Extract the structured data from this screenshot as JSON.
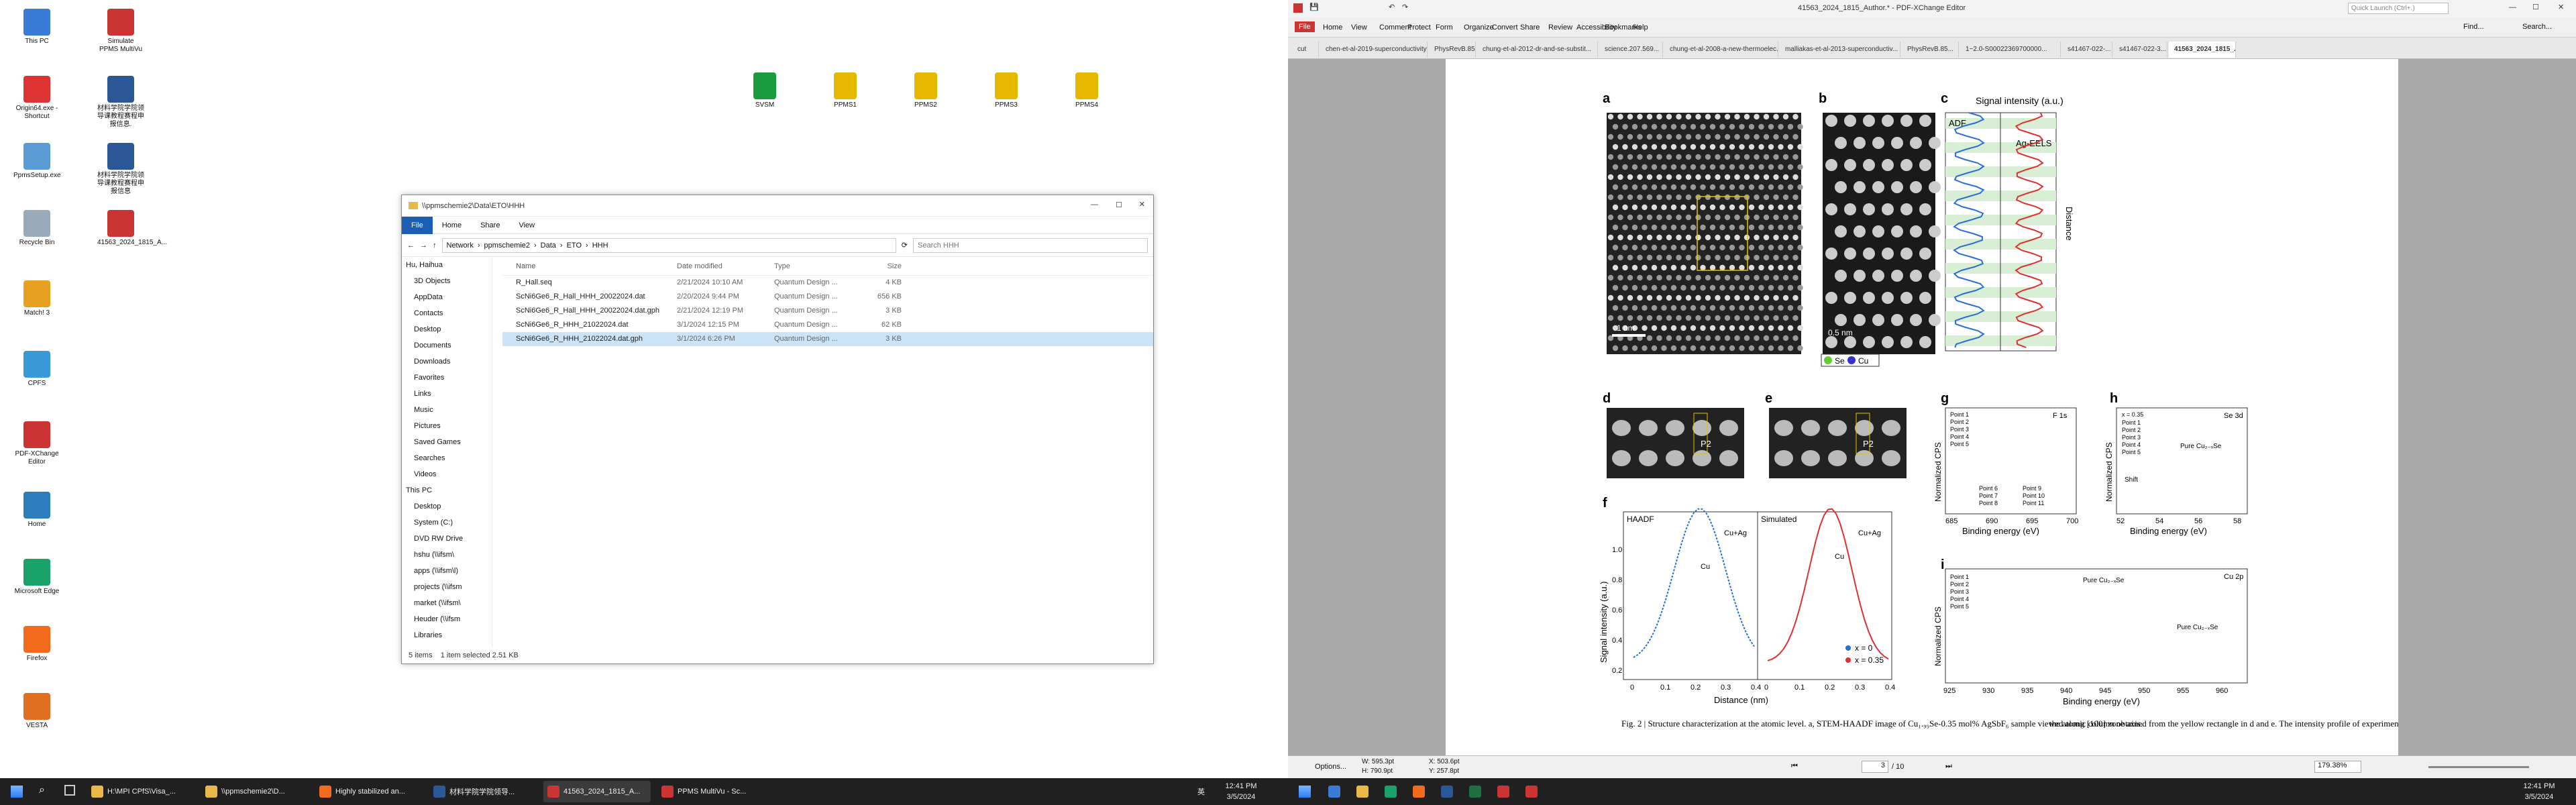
{
  "desktop_left": {
    "icons": [
      {
        "label": "This PC",
        "color": "#3a7bd5"
      },
      {
        "label": "Simulate PPMS MultiVu",
        "color": "#c33"
      },
      {
        "label": "Origin64.exe - Shortcut",
        "color": "#d33"
      },
      {
        "label": "材料学院学院领导课教程赛程申报信息.",
        "color": "#2b5797"
      },
      {
        "label": "PpmsSetup.exe",
        "color": "#5b9bd5"
      },
      {
        "label": "材料学院学院领导课教程赛程申报信息",
        "color": "#2b5797"
      },
      {
        "label": "Recycle Bin",
        "color": "#9ab"
      },
      {
        "label": "41563_2024_1815_A...",
        "color": "#c33"
      },
      {
        "label": "Match! 3",
        "color": "#e8a020"
      },
      {
        "label": "CPFS",
        "color": "#3a9ad9"
      },
      {
        "label": "PDF-XChange Editor",
        "color": "#c33"
      },
      {
        "label": "Home",
        "color": "#2c7dbe"
      },
      {
        "label": "Microsoft Edge",
        "color": "#1aa26b"
      },
      {
        "label": "Firefox",
        "color": "#f26b1d"
      },
      {
        "label": "VESTA",
        "color": "#e07020"
      }
    ],
    "shortcuts": [
      {
        "label": "SVSM",
        "color": "#1a9c3e"
      },
      {
        "label": "PPMS1",
        "color": "#e6b800"
      },
      {
        "label": "PPMS2",
        "color": "#e6b800"
      },
      {
        "label": "PPMS3",
        "color": "#e6b800"
      },
      {
        "label": "PPMS4",
        "color": "#e6b800"
      }
    ]
  },
  "explorer": {
    "title": "\\\\ppmschemie2\\Data\\ETO\\HHH",
    "ribbon": [
      "File",
      "Home",
      "Share",
      "View"
    ],
    "path": [
      "Network",
      "ppmschemie2",
      "Data",
      "ETO",
      "HHH"
    ],
    "search_placeholder": "Search HHH",
    "nav": [
      "Hu, Haihua",
      "3D Objects",
      "AppData",
      "Contacts",
      "Desktop",
      "Documents",
      "Downloads",
      "Favorites",
      "Links",
      "Music",
      "Pictures",
      "Saved Games",
      "Searches",
      "Videos",
      "This PC",
      "Desktop",
      "System (C:)",
      "DVD RW Drive",
      "hshu (\\\\ifsm\\",
      "apps (\\\\ifsm\\l)",
      "projects (\\\\ifsm",
      "market (\\\\ifsm\\",
      "Heuder (\\\\ifsm",
      "Libraries"
    ],
    "columns": [
      "Name",
      "Date modified",
      "Type",
      "Size"
    ],
    "files": [
      {
        "name": "R_Hall.seq",
        "date": "2/21/2024 10:10 AM",
        "type": "Quantum Design ...",
        "size": "4 KB"
      },
      {
        "name": "ScNi6Ge6_R_Hall_HHH_20022024.dat",
        "date": "2/20/2024 9:44 PM",
        "type": "Quantum Design ...",
        "size": "656 KB"
      },
      {
        "name": "ScNi6Ge6_R_Hall_HHH_20022024.dat.gph",
        "date": "2/21/2024 12:19 PM",
        "type": "Quantum Design ...",
        "size": "3 KB"
      },
      {
        "name": "ScNi6Ge6_R_HHH_21022024.dat",
        "date": "3/1/2024 12:15 PM",
        "type": "Quantum Design ...",
        "size": "62 KB"
      },
      {
        "name": "ScNi6Ge6_R_HHH_21022024.dat.gph",
        "date": "3/1/2024 6:26 PM",
        "type": "Quantum Design ...",
        "size": "3 KB"
      }
    ],
    "status": [
      "5 items",
      "1 item selected 2.51 KB"
    ]
  },
  "taskbar_left": {
    "items": [
      "H:\\MPI CPfS\\Visa_...",
      "\\\\ppmschemie2\\D...",
      "Highly stabilized an...",
      "材料学院学院领导...",
      "41563_2024_1815_A...",
      "PPMS MultiVu - Sc..."
    ],
    "time": "12:41 PM",
    "date": "3/5/2024",
    "lang": "英"
  },
  "taskbar_right": {
    "time": "12:41 PM",
    "date": "3/5/2024"
  },
  "pdf": {
    "title": "41563_2024_1815_Author.* - PDF-XChange Editor",
    "quick_launch": "Quick Launch (Ctrl+.)",
    "menu": [
      "File",
      "Home",
      "View",
      "Comment",
      "Protect",
      "Form",
      "Organize",
      "Convert",
      "Share",
      "Review",
      "Accessibility",
      "Bookmarks",
      "Help"
    ],
    "find": "Find...",
    "search": "Search...",
    "tabs": [
      "cut",
      "chen-et-al-2019-superconductivity-a...",
      "PhysRevB.85...",
      "chung-et-al-2012-dr-and-se-substit...",
      "science.207.569...",
      "chung-et-al-2008-a-new-thermoelec...",
      "malliakas-et-al-2013-superconductiv...",
      "PhysRevB.85...",
      "1~2.0-S00022369700000...",
      "s41467-022-...",
      "s41467-022-3...",
      "41563_2024_1815_..."
    ],
    "status": {
      "options": "Options...",
      "w": "W: 595.3pt",
      "h": "H: 790.9pt",
      "x": "X: 503.6pt",
      "y": "Y: 257.8pt",
      "page": "3",
      "total": "/ 10",
      "zoom": "179.38%"
    }
  },
  "figure": {
    "panels": [
      "a",
      "b",
      "c",
      "d",
      "e",
      "f",
      "g",
      "h",
      "i"
    ],
    "scale_a": "1 nm",
    "scale_b": "0.5 nm",
    "legend_b": [
      "Se",
      "Cu"
    ],
    "c_title": "Signal intensity (a.u.)",
    "c_adf": "ADF",
    "c_eels": "Ag-EELS",
    "c_dist": "Distance",
    "d_label": "P2",
    "e_label": "P2",
    "f": {
      "ylabel": "Signal intensity (a.u.)",
      "xlabel": "Distance (nm)",
      "left_title": "HAADF",
      "right_title": "Simulated",
      "cuag": "Cu+Ag",
      "cu": "Cu",
      "legend": [
        "x = 0",
        "x = 0.35"
      ],
      "yticks": [
        "0.2",
        "0.4",
        "0.6",
        "0.8",
        "1.0"
      ],
      "xticks": [
        "0",
        "0.1",
        "0.2",
        "0.3",
        "0.4"
      ]
    },
    "g": {
      "title": "F 1s",
      "xlabel": "Binding energy (eV)",
      "ylabel": "Normalized CPS",
      "xticks": [
        "685",
        "690",
        "695",
        "700"
      ],
      "points": [
        "Point 1",
        "Point 2",
        "Point 3",
        "Point 4",
        "Point 5",
        "Point 6",
        "Point 7",
        "Point 8",
        "Point 9",
        "Point 10",
        "Point 11"
      ]
    },
    "h": {
      "title": "Se 3d",
      "xlabel": "Binding energy (eV)",
      "ylabel": "Normalized CPS",
      "xticks": [
        "52",
        "54",
        "56",
        "58"
      ],
      "x035": "x = 0.35",
      "shift": "Shift",
      "pure": "Pure Cu₂₋ₓSe",
      "points": [
        "Point 1",
        "Point 2",
        "Point 3",
        "Point 4",
        "Point 5"
      ]
    },
    "i": {
      "title": "Cu 2p",
      "xlabel": "Binding energy (eV)",
      "ylabel": "Normalized CPS",
      "xticks": [
        "925",
        "930",
        "935",
        "940",
        "945",
        "950",
        "955",
        "960"
      ],
      "pure": "Pure Cu₂₋ₓSe",
      "points": [
        "Point 1",
        "Point 2",
        "Point 3",
        "Point 4",
        "Point 5"
      ]
    },
    "caption_left": "Fig. 2 | Structure characterization at the atomic level. a, STEM-HAADF image of Cu₁.₉₉Se-0.35 mol% AgSbF₆ sample viewed along [100] zone axis.",
    "caption_right": "the atomic column obtained from the yellow rectangle in d and e. The intensity profile of experimental STEM-HAADF images is normalized by the P1 position"
  }
}
